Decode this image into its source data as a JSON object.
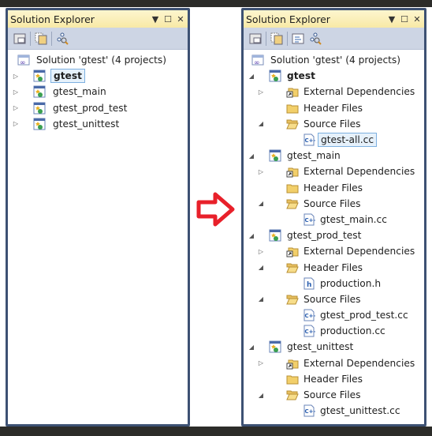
{
  "colors": {
    "frame": "#3d5173",
    "title_bar": "#f8e9a6",
    "toolbar": "#cdd5e4",
    "arrow": "#e8202a",
    "selection": "#7db0e0"
  },
  "left_panel": {
    "title": "Solution Explorer",
    "title_buttons": [
      "dropdown-icon",
      "maximize-icon",
      "close-icon"
    ],
    "toolbar": [
      "properties-icon",
      "show-all-files-icon",
      "class-view-icon"
    ],
    "tree": [
      {
        "label": "Solution 'gtest' (4 projects)",
        "type": "solution",
        "level": 0
      },
      {
        "label": "gtest",
        "type": "project",
        "level": 1,
        "expander": "collapsed",
        "bold": true,
        "selected": true
      },
      {
        "label": "gtest_main",
        "type": "project",
        "level": 1,
        "expander": "collapsed"
      },
      {
        "label": "gtest_prod_test",
        "type": "project",
        "level": 1,
        "expander": "collapsed"
      },
      {
        "label": "gtest_unittest",
        "type": "project",
        "level": 1,
        "expander": "collapsed"
      }
    ]
  },
  "arrow_icon": "right-arrow-icon",
  "right_panel": {
    "title": "Solution Explorer",
    "title_buttons": [
      "dropdown-icon",
      "maximize-icon",
      "close-icon"
    ],
    "toolbar": [
      "properties-icon",
      "show-all-files-icon",
      "view-code-icon",
      "class-view-icon"
    ],
    "tree": [
      {
        "label": "Solution 'gtest' (4 projects)",
        "type": "solution",
        "level": 0
      },
      {
        "label": "gtest",
        "type": "project",
        "level": 1,
        "expander": "expanded",
        "bold": true
      },
      {
        "label": "External Dependencies",
        "type": "extdeps",
        "level": 2,
        "expander": "collapsed"
      },
      {
        "label": "Header Files",
        "type": "folder",
        "level": 2
      },
      {
        "label": "Source Files",
        "type": "folder-open",
        "level": 2,
        "expander": "expanded"
      },
      {
        "label": "gtest-all.cc",
        "type": "cpp",
        "level": 3,
        "selected": true
      },
      {
        "label": "gtest_main",
        "type": "project",
        "level": 1,
        "expander": "expanded"
      },
      {
        "label": "External Dependencies",
        "type": "extdeps",
        "level": 2,
        "expander": "collapsed"
      },
      {
        "label": "Header Files",
        "type": "folder",
        "level": 2
      },
      {
        "label": "Source Files",
        "type": "folder-open",
        "level": 2,
        "expander": "expanded"
      },
      {
        "label": "gtest_main.cc",
        "type": "cpp",
        "level": 3
      },
      {
        "label": "gtest_prod_test",
        "type": "project",
        "level": 1,
        "expander": "expanded"
      },
      {
        "label": "External Dependencies",
        "type": "extdeps",
        "level": 2,
        "expander": "collapsed"
      },
      {
        "label": "Header Files",
        "type": "folder-open",
        "level": 2,
        "expander": "expanded"
      },
      {
        "label": "production.h",
        "type": "header",
        "level": 3
      },
      {
        "label": "Source Files",
        "type": "folder-open",
        "level": 2,
        "expander": "expanded"
      },
      {
        "label": "gtest_prod_test.cc",
        "type": "cpp",
        "level": 3
      },
      {
        "label": "production.cc",
        "type": "cpp",
        "level": 3
      },
      {
        "label": "gtest_unittest",
        "type": "project",
        "level": 1,
        "expander": "expanded"
      },
      {
        "label": "External Dependencies",
        "type": "extdeps",
        "level": 2,
        "expander": "collapsed"
      },
      {
        "label": "Header Files",
        "type": "folder",
        "level": 2
      },
      {
        "label": "Source Files",
        "type": "folder-open",
        "level": 2,
        "expander": "expanded"
      },
      {
        "label": "gtest_unittest.cc",
        "type": "cpp",
        "level": 3
      }
    ]
  }
}
